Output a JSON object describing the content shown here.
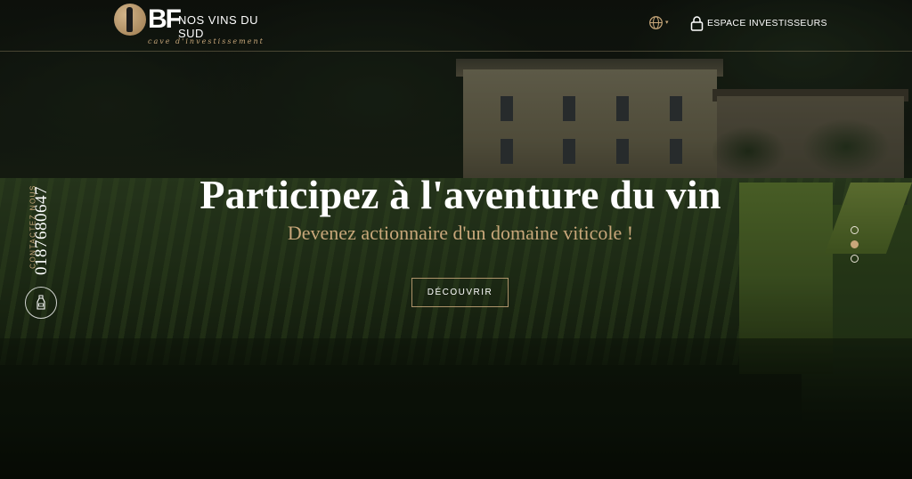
{
  "brand": {
    "initials": "BF",
    "name": "NOS VINS DU SUD",
    "tagline": "cave d'investissement"
  },
  "header": {
    "language_icon": "globe-icon",
    "investors_icon": "lock-icon",
    "investors_label": "ESPACE INVESTISSEURS"
  },
  "hero": {
    "title": "Participez à l'aventure du vin",
    "subtitle": "Devenez actionnaire d'un domaine viticole !",
    "cta_label": "DÉCOUVRIR"
  },
  "contact": {
    "label": "CONTACTEZ NOUS",
    "phone": "0187680647",
    "button_icon": "wine-bottle-icon"
  },
  "slider": {
    "count": 3,
    "active_index": 1
  },
  "colors": {
    "accent_gold": "#c8a77a",
    "text": "#ffffff"
  }
}
